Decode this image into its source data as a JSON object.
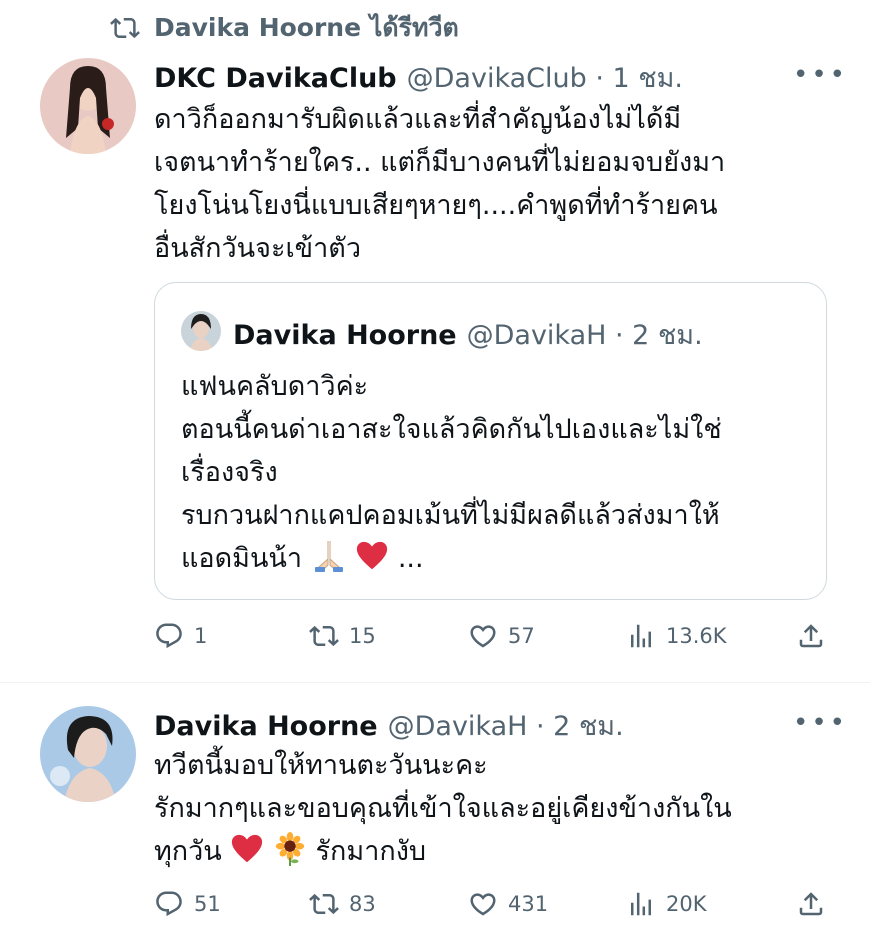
{
  "retweet_header": {
    "text": "Davika Hoorne ได้รีทวีต"
  },
  "tweet1": {
    "name": "DKC DavikaClub",
    "handle_time": "@DavikaClub · 1 ชม.",
    "more": "•••",
    "lines": [
      "ดาวิก็ออกมารับผิดแล้วและที่สำคัญน้องไม่ได้มี",
      "เจตนาทำร้ายใคร.. แต่ก็มีบางคนที่ไม่ยอมจบยังมา",
      "โยงโน่นโยงนี่แบบเสียๆหายๆ....คำพูดที่ทำร้ายคน",
      "อื่นสักวันจะเข้าตัว"
    ],
    "quote": {
      "name": "Davika Hoorne",
      "handle_time": "@DavikaH · 2 ชม.",
      "lines": [
        "แฟนคลับดาวิค่ะ",
        "ตอนนี้คนด่าเอาสะใจแล้วคิดกันไปเองและไม่ใช่",
        "เรื่องจริง",
        "รบกวนฝากแคปคอมเม้นที่ไม่มีผลดีแล้วส่งมาให้",
        "แอดมินน้า"
      ],
      "ellipsis": "..."
    },
    "stats": {
      "replies": "1",
      "retweets": "15",
      "likes": "57",
      "views": "13.6K"
    }
  },
  "tweet2": {
    "name": "Davika Hoorne",
    "handle_time": "@DavikaH · 2 ชม.",
    "more": "•••",
    "lines": [
      "ทวีตนี้มอบให้ทานตะวันนะคะ",
      "รักมากๆและขอบคุณที่เข้าใจและอยู่เคียงข้างกันใน"
    ],
    "line3_start": "ทุกวัน",
    "line3_end": "รักมากงับ",
    "stats": {
      "replies": "51",
      "retweets": "83",
      "likes": "431",
      "views": "20K"
    }
  },
  "icons": {
    "retweet": "retweet-icon",
    "reply": "reply-icon",
    "like": "heart-icon",
    "views": "views-icon",
    "share": "share-icon"
  },
  "colors": {
    "text": "#0f1419",
    "secondary": "#536471",
    "border": "#cfd9de",
    "heart": "#e0245e"
  }
}
